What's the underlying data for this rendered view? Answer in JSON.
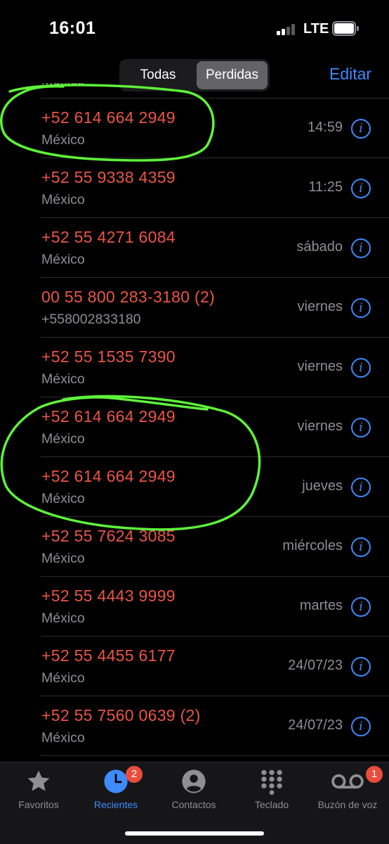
{
  "status_bar": {
    "time": "16:01",
    "network": "LTE"
  },
  "nav": {
    "segments": [
      "Todas",
      "Perdidas"
    ],
    "selected_segment": "Perdidas",
    "edit_label": "Editar"
  },
  "calls": [
    {
      "number": "+52 614 664 2949",
      "label": "México",
      "time": "14:59"
    },
    {
      "number": "+52 55 9338 4359",
      "label": "México",
      "time": "11:25"
    },
    {
      "number": "+52 55 4271 6084",
      "label": "México",
      "time": "sábado"
    },
    {
      "number": "00 55 800 283-3180 (2)",
      "label": "+558002833180",
      "time": "viernes"
    },
    {
      "number": "+52 55 1535 7390",
      "label": "México",
      "time": "viernes"
    },
    {
      "number": "+52 614 664 2949",
      "label": "México",
      "time": "viernes"
    },
    {
      "number": "+52 614 664 2949",
      "label": "México",
      "time": "jueves"
    },
    {
      "number": "+52 55 7624 3085",
      "label": "México",
      "time": "miércoles"
    },
    {
      "number": "+52 55 4443 9999",
      "label": "México",
      "time": "martes"
    },
    {
      "number": "+52 55 4455 6177",
      "label": "México",
      "time": "24/07/23"
    },
    {
      "number": "+52 55 7560 0639 (2)",
      "label": "México",
      "time": "24/07/23"
    }
  ],
  "partial_top_label": "México",
  "info_glyph": "i",
  "tabs": [
    {
      "label": "Favoritos",
      "icon": "star-icon"
    },
    {
      "label": "Recientes",
      "icon": "clock-icon",
      "badge": "2",
      "active": true
    },
    {
      "label": "Contactos",
      "icon": "person-circle-icon"
    },
    {
      "label": "Teclado",
      "icon": "keypad-icon"
    },
    {
      "label": "Buzón de voz",
      "icon": "voicemail-icon",
      "badge": "1"
    }
  ],
  "colors": {
    "missed_call": "#eb5545",
    "accent": "#3d8bfd",
    "annotation": "#5ef23a",
    "badge": "#eb4d3d"
  }
}
